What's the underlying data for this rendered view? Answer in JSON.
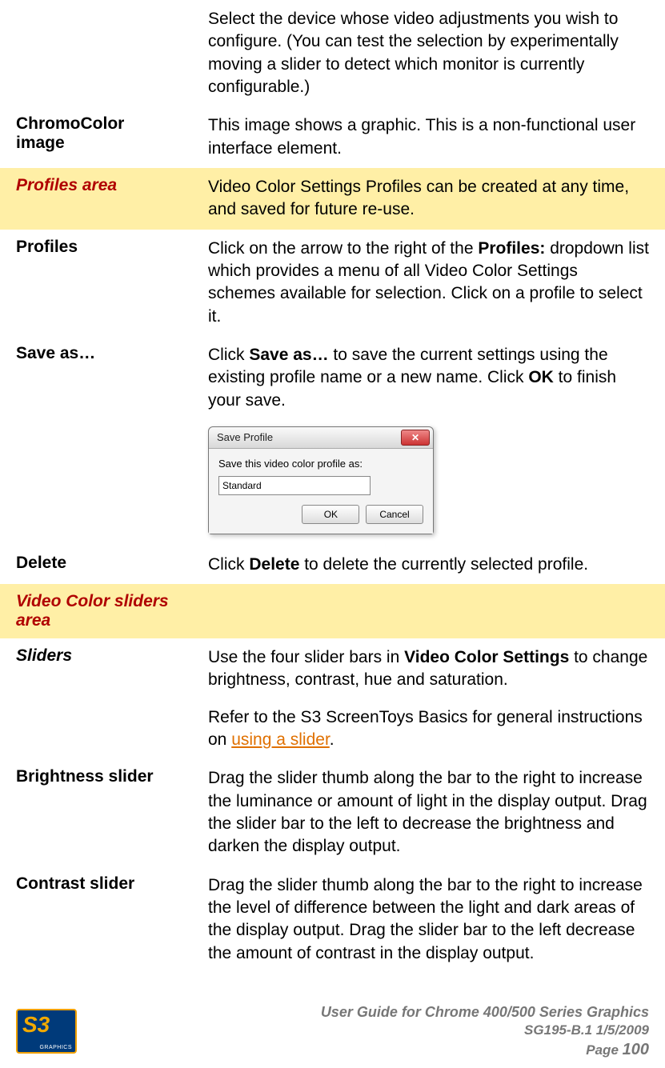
{
  "rows": {
    "intro_desc": "Select the device whose video adjustments you wish to configure. (You can test the selection by experimentally moving a slider to detect which monitor is currently configurable.)",
    "chromo_label": "ChromoColor image",
    "chromo_desc": "This image shows a graphic. This is a non-functional user interface element.",
    "profiles_area_label": "Profiles area",
    "profiles_area_desc": "Video Color Settings Profiles can be created at any time, and saved for future re-use.",
    "profiles_label": "Profiles",
    "profiles_desc_pre": "Click on the arrow to the right of the ",
    "profiles_desc_bold": "Profiles:",
    "profiles_desc_post": " dropdown list which provides a menu of all Video Color Settings schemes available for selection. Click on a profile to select it.",
    "saveas_label": "Save as…",
    "saveas_desc_pre": "Click ",
    "saveas_desc_b1": "Save as…",
    "saveas_desc_mid": " to save the current settings using the existing profile name or a new name. Click ",
    "saveas_desc_b2": "OK",
    "saveas_desc_post": " to finish your save.",
    "delete_label": "Delete",
    "delete_desc_pre": "Click ",
    "delete_desc_b": "Delete",
    "delete_desc_post": " to delete the currently selected profile.",
    "sliders_area_label": "Video Color sliders area",
    "sliders_label": "Sliders",
    "sliders_desc_pre": "Use the four slider bars in ",
    "sliders_desc_b": "Video Color Settings",
    "sliders_desc_post": " to change brightness, contrast, hue and saturation.",
    "sliders_refer_pre": "Refer to the S3 ScreenToys Basics for general instructions on ",
    "sliders_refer_link": "using a slider",
    "sliders_refer_post": ".",
    "brightness_label": "Brightness slider",
    "brightness_desc": "Drag the slider thumb along the bar to the right to increase the luminance or amount of light in the display output. Drag the slider bar to the left to decrease the brightness and darken the display output.",
    "contrast_label": "Contrast slider",
    "contrast_desc": "Drag the slider thumb along the bar to the right to increase the level of difference between the light and dark areas of the display output. Drag the slider bar to the left decrease the amount of contrast in the display output."
  },
  "dialog": {
    "title": "Save Profile",
    "label": "Save this video color profile as:",
    "value": "Standard",
    "ok": "OK",
    "cancel": "Cancel"
  },
  "footer": {
    "logo_main": "S3",
    "logo_sub": "GRAPHICS",
    "line1": "User Guide for Chrome 400/500 Series Graphics",
    "line2": "SG195-B.1   1/5/2009",
    "line3_pre": "Page ",
    "line3_num": "100"
  }
}
